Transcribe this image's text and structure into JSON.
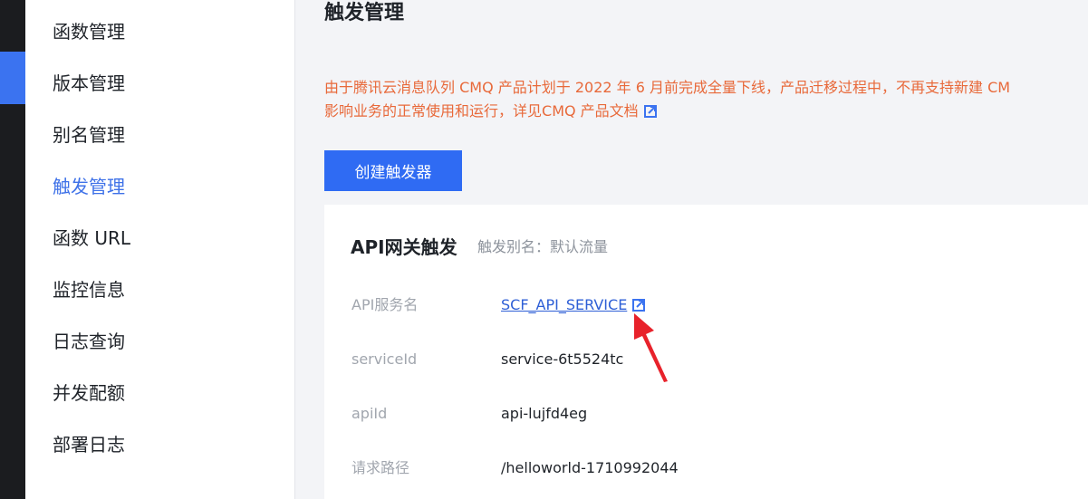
{
  "colors": {
    "accent": "#2f6bf3",
    "nav_active": "#3f72e8",
    "warning_text": "#e8693a",
    "link": "#2e5fd6",
    "annotation_arrow": "#e8222b"
  },
  "sidebar": {
    "items": [
      {
        "label": "函数管理",
        "active": false
      },
      {
        "label": "版本管理",
        "active": false
      },
      {
        "label": "别名管理",
        "active": false
      },
      {
        "label": "触发管理",
        "active": true
      },
      {
        "label": "函数 URL",
        "active": false
      },
      {
        "label": "监控信息",
        "active": false
      },
      {
        "label": "日志查询",
        "active": false
      },
      {
        "label": "并发配额",
        "active": false
      },
      {
        "label": "部署日志",
        "active": false
      }
    ]
  },
  "main": {
    "title": "触发管理",
    "notice": {
      "line1": "由于腾讯云消息队列 CMQ 产品计划于 2022 年 6 月前完成全量下线，产品迁移过程中，不再支持新建 CM",
      "line2_prefix": "影响业务的正常使用和运行，详见",
      "link_text": "CMQ 产品文档",
      "link_icon": "external-link-icon"
    },
    "create_button": "创建触发器",
    "trigger_card": {
      "title": "API网关触发",
      "alias": "触发别名：默认流量",
      "rows": [
        {
          "label": "API服务名",
          "value": "SCF_API_SERVICE",
          "is_link": true,
          "icon": "external-link-icon"
        },
        {
          "label": "serviceId",
          "value": "service-6t5524tc",
          "is_link": false
        },
        {
          "label": "apiId",
          "value": "api-lujfd4eg",
          "is_link": false
        },
        {
          "label": "请求路径",
          "value": "/helloworld-1710992044",
          "is_link": false
        }
      ]
    }
  }
}
